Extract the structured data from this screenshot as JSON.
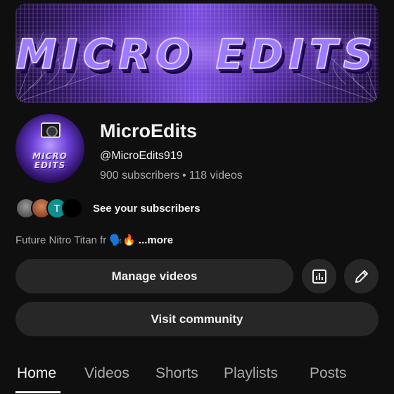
{
  "banner": {
    "text": "MICRO EDITS"
  },
  "avatar": {
    "text_line1": "MICRO",
    "text_line2": "EDITS"
  },
  "channel": {
    "name": "MicroEdits",
    "handle": "@MicroEdits919",
    "subscribers": "900 subscribers",
    "separator": "•",
    "videos": "118 videos"
  },
  "subscribers_preview": {
    "avatars": [
      "photo-avatar",
      "photo-avatar",
      "T",
      "dark-avatar"
    ],
    "label": "See your subscribers"
  },
  "description": {
    "text": "Future Nitro Titan fr 🗣️🔥",
    "more": "...more"
  },
  "buttons": {
    "manage": "Manage videos",
    "stats_icon": "analytics-icon",
    "edit_icon": "pencil-icon",
    "community": "Visit community"
  },
  "tabs": [
    {
      "label": "Home",
      "active": true
    },
    {
      "label": "Videos",
      "active": false
    },
    {
      "label": "Shorts",
      "active": false
    },
    {
      "label": "Playlists",
      "active": false
    },
    {
      "label": "Posts",
      "active": false
    }
  ],
  "colors": {
    "background": "#0f0f0f",
    "button": "#272727",
    "accent_purple": "#7b4fe0",
    "secondary_text": "#aaaaaa"
  }
}
